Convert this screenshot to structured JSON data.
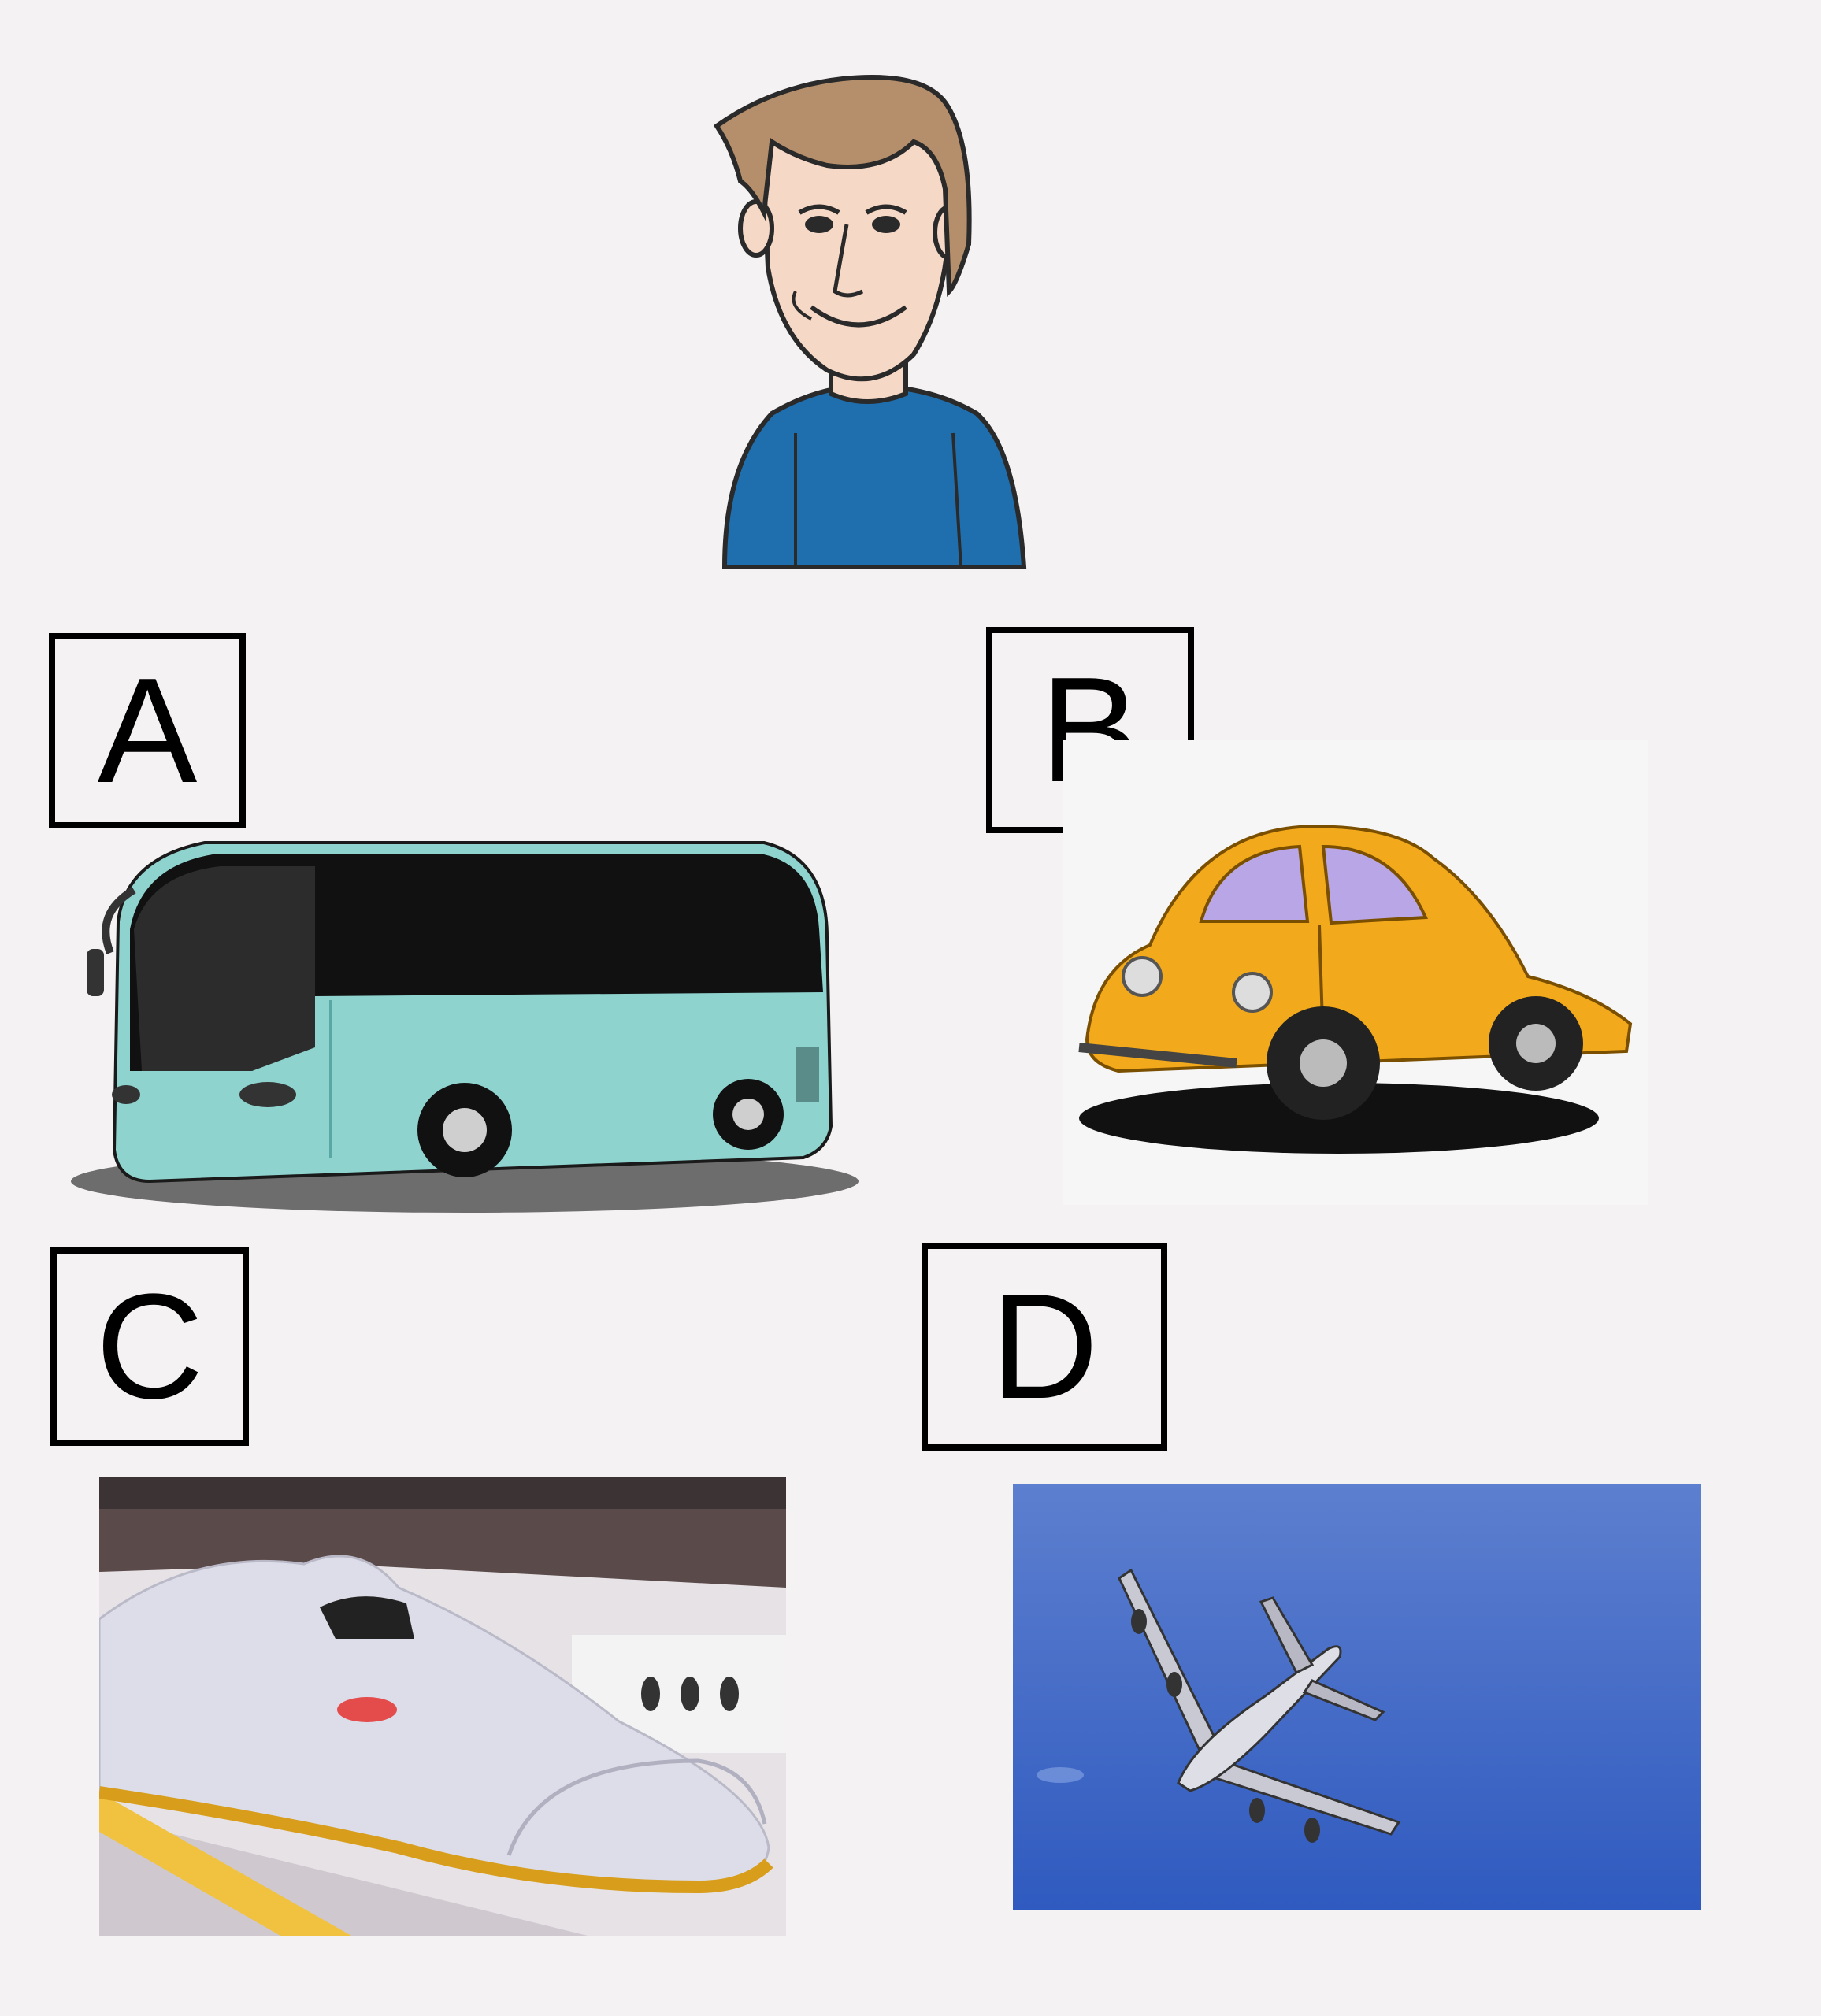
{
  "question": {
    "subject_icon": "boy-icon",
    "options": [
      {
        "letter": "A",
        "icon": "bus-icon"
      },
      {
        "letter": "B",
        "icon": "car-icon"
      },
      {
        "letter": "C",
        "icon": "train-icon"
      },
      {
        "letter": "D",
        "icon": "airplane-icon"
      }
    ]
  },
  "colors": {
    "background": "#f4f2f2",
    "shirt": "#1f6fae",
    "hair": "#b58f6b",
    "bus_body": "#8fd3cf",
    "car_body": "#f2a91b",
    "car_windows": "#b9a6e6",
    "sky": "#3f66c4"
  }
}
